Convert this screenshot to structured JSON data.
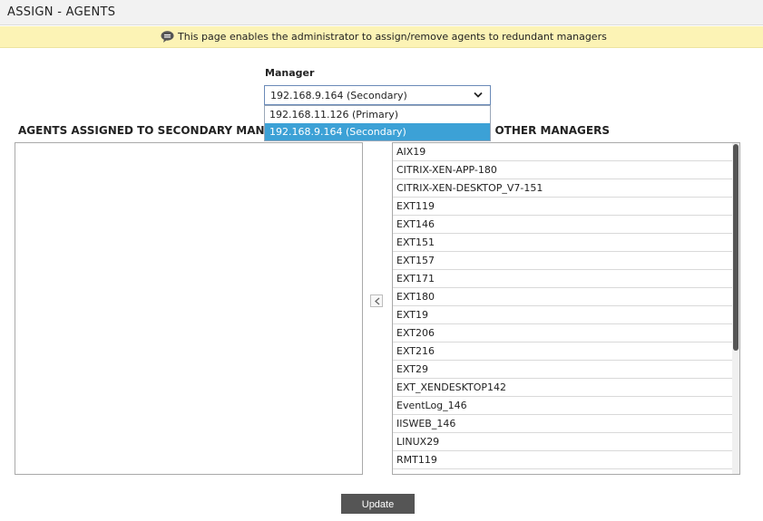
{
  "page": {
    "title": "ASSIGN - AGENTS"
  },
  "info": {
    "text": "This page enables the administrator to assign/remove agents to redundant managers",
    "icon": "chat-bubble-icon"
  },
  "manager": {
    "label": "Manager",
    "selected": "192.168.9.164 (Secondary)",
    "options": [
      {
        "label": "192.168.11.126 (Primary)",
        "highlighted": false
      },
      {
        "label": "192.168.9.164 (Secondary)",
        "highlighted": true
      }
    ]
  },
  "left_panel": {
    "header": "AGENTS ASSIGNED TO SECONDARY MANAGER",
    "items": []
  },
  "right_panel": {
    "header": "D TO OTHER MANAGERS",
    "items": [
      "AIX19",
      "CITRIX-XEN-APP-180",
      "CITRIX-XEN-DESKTOP_V7-151",
      "EXT119",
      "EXT146",
      "EXT151",
      "EXT157",
      "EXT171",
      "EXT180",
      "EXT19",
      "EXT206",
      "EXT216",
      "EXT29",
      "EXT_XENDESKTOP142",
      "EventLog_146",
      "IISWEB_146",
      "LINUX29",
      "RMT119"
    ]
  },
  "move_left_icon": "chevron-left-icon",
  "update_label": "Update",
  "colors": {
    "info_bg": "#fcf3b5",
    "highlight": "#3ca1d6",
    "button": "#555555"
  }
}
